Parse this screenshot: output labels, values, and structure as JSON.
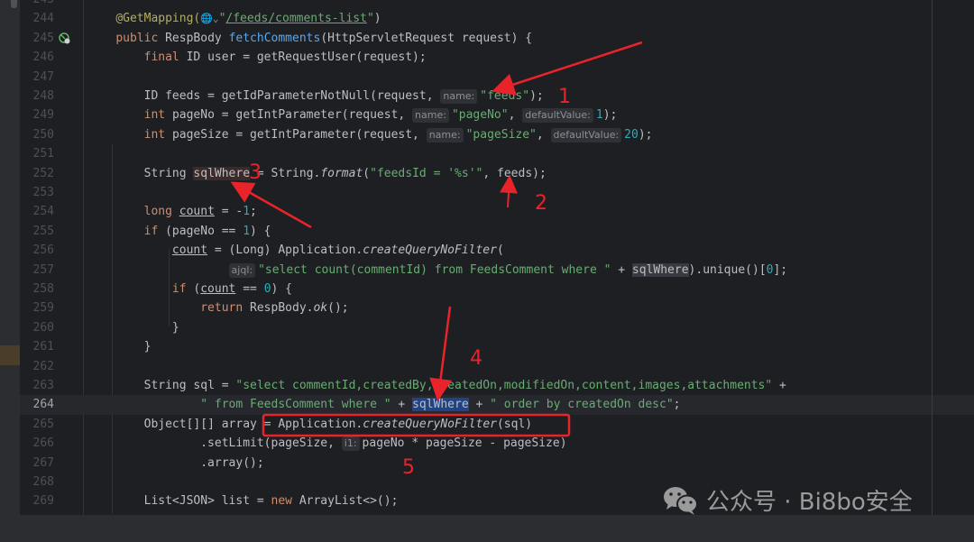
{
  "editor": {
    "current_line": "264",
    "lines": [
      {
        "n": "243",
        "indent": 0,
        "tokens": []
      },
      {
        "n": "244",
        "indent": 4,
        "tokens": [
          [
            "@GetMapping(",
            "ann"
          ],
          [
            "🌐⌄",
            "globe"
          ],
          [
            "\"",
            "str"
          ],
          [
            "/feeds/comments-list",
            "url"
          ],
          [
            "\"",
            "str"
          ],
          [
            ")",
            ""
          ]
        ]
      },
      {
        "n": "245",
        "indent": 4,
        "icon": "endpoint-globe-icon",
        "tokens": [
          [
            "public ",
            "kw"
          ],
          [
            "RespBody ",
            ""
          ],
          [
            "fetchComments",
            "fn"
          ],
          [
            "(HttpServletRequest request) {",
            ""
          ]
        ]
      },
      {
        "n": "246",
        "indent": 8,
        "tokens": [
          [
            "final ",
            "kw"
          ],
          [
            "ID user = getRequestUser(request);",
            ""
          ]
        ]
      },
      {
        "n": "247",
        "indent": 0,
        "tokens": []
      },
      {
        "n": "248",
        "indent": 8,
        "tokens": [
          [
            "ID feeds = getIdParameterNotNull(request, ",
            ""
          ],
          [
            "name:",
            "hint"
          ],
          [
            "\"feeds\"",
            "str"
          ],
          [
            ");",
            ""
          ]
        ]
      },
      {
        "n": "249",
        "indent": 8,
        "tokens": [
          [
            "int ",
            "kw"
          ],
          [
            "pageNo = getIntParameter(request, ",
            ""
          ],
          [
            "name:",
            "hint"
          ],
          [
            "\"pageNo\"",
            "str"
          ],
          [
            ", ",
            ""
          ],
          [
            "defaultValue:",
            "hint"
          ],
          [
            "1",
            "num"
          ],
          [
            ");",
            ""
          ]
        ]
      },
      {
        "n": "250",
        "indent": 8,
        "tokens": [
          [
            "int ",
            "kw"
          ],
          [
            "pageSize = getIntParameter(request, ",
            ""
          ],
          [
            "name:",
            "hint"
          ],
          [
            "\"pageSize\"",
            "str"
          ],
          [
            ", ",
            ""
          ],
          [
            "defaultValue:",
            "hint"
          ],
          [
            "20",
            "num"
          ],
          [
            ");",
            ""
          ]
        ]
      },
      {
        "n": "251",
        "indent": 0,
        "tokens": []
      },
      {
        "n": "252",
        "indent": 8,
        "tokens": [
          [
            "String ",
            ""
          ],
          [
            "sqlWhere",
            "hl3"
          ],
          [
            " = String.",
            ""
          ],
          [
            "format",
            "it"
          ],
          [
            "(",
            ""
          ],
          [
            "\"feedsId = '%s'\"",
            "str"
          ],
          [
            ", feeds);",
            ""
          ]
        ]
      },
      {
        "n": "253",
        "indent": 0,
        "tokens": []
      },
      {
        "n": "254",
        "indent": 8,
        "tokens": [
          [
            "long ",
            "kw"
          ],
          [
            "count",
            "ul"
          ],
          [
            " = -",
            ""
          ],
          [
            "1",
            "num"
          ],
          [
            ";",
            ""
          ]
        ]
      },
      {
        "n": "255",
        "indent": 8,
        "tokens": [
          [
            "if ",
            "kw"
          ],
          [
            "(pageNo == ",
            ""
          ],
          [
            "1",
            "num"
          ],
          [
            ") {",
            ""
          ]
        ]
      },
      {
        "n": "256",
        "indent": 12,
        "tokens": [
          [
            "count",
            "ul"
          ],
          [
            " = (Long) Application.",
            ""
          ],
          [
            "createQueryNoFilter",
            "it"
          ],
          [
            "(",
            ""
          ]
        ]
      },
      {
        "n": "257",
        "indent": 20,
        "tokens": [
          [
            "ajql:",
            "hint"
          ],
          [
            "\"select count(commentId) from FeedsComment where \"",
            "str"
          ],
          [
            " + ",
            ""
          ],
          [
            "sqlWhere",
            "hl"
          ],
          [
            ").unique()[",
            ""
          ],
          [
            "0",
            "num"
          ],
          [
            "];",
            ""
          ]
        ]
      },
      {
        "n": "258",
        "indent": 12,
        "tokens": [
          [
            "if ",
            "kw"
          ],
          [
            "(",
            ""
          ],
          [
            "count",
            "ul"
          ],
          [
            " == ",
            ""
          ],
          [
            "0",
            "num"
          ],
          [
            ") {",
            ""
          ]
        ]
      },
      {
        "n": "259",
        "indent": 16,
        "tokens": [
          [
            "return ",
            "kw"
          ],
          [
            "RespBody.",
            ""
          ],
          [
            "ok",
            "it"
          ],
          [
            "();",
            ""
          ]
        ]
      },
      {
        "n": "260",
        "indent": 12,
        "tokens": [
          [
            "}",
            ""
          ]
        ]
      },
      {
        "n": "261",
        "indent": 8,
        "tokens": [
          [
            "}",
            ""
          ]
        ]
      },
      {
        "n": "262",
        "indent": 0,
        "tokens": []
      },
      {
        "n": "263",
        "indent": 8,
        "tokens": [
          [
            "String sql = ",
            ""
          ],
          [
            "\"select commentId,createdBy,createdOn,modifiedOn,content,images,attachments\"",
            "str"
          ],
          [
            " +",
            ""
          ]
        ]
      },
      {
        "n": "264",
        "indent": 16,
        "tokens": [
          [
            "\" from FeedsComment where \"",
            "str"
          ],
          [
            " + ",
            ""
          ],
          [
            "sqlWhere",
            "sel"
          ],
          [
            " + ",
            ""
          ],
          [
            "\" order by createdOn desc\"",
            "str"
          ],
          [
            ";",
            ""
          ]
        ]
      },
      {
        "n": "265",
        "indent": 8,
        "tokens": [
          [
            "Object[][] array = Application.",
            ""
          ],
          [
            "createQueryNoFilter",
            "it"
          ],
          [
            "(sql)",
            ""
          ]
        ]
      },
      {
        "n": "266",
        "indent": 16,
        "tokens": [
          [
            ".setLimit(pageSize, ",
            ""
          ],
          [
            "i1:",
            "hint"
          ],
          [
            "pageNo * pageSize - pageSize)",
            ""
          ]
        ]
      },
      {
        "n": "267",
        "indent": 16,
        "tokens": [
          [
            ".array();",
            ""
          ]
        ]
      },
      {
        "n": "268",
        "indent": 0,
        "tokens": []
      },
      {
        "n": "269",
        "indent": 8,
        "tokens": [
          [
            "List<JSON> list = ",
            ""
          ],
          [
            "new ",
            "kw"
          ],
          [
            "ArrayList<>();",
            ""
          ]
        ]
      }
    ]
  },
  "annotations": {
    "color": "#e8242a",
    "labels": [
      "1",
      "2",
      "3",
      "4",
      "5"
    ]
  },
  "watermark": {
    "icon": "wechat-icon",
    "text": "公众号 · Bi8bo安全"
  }
}
